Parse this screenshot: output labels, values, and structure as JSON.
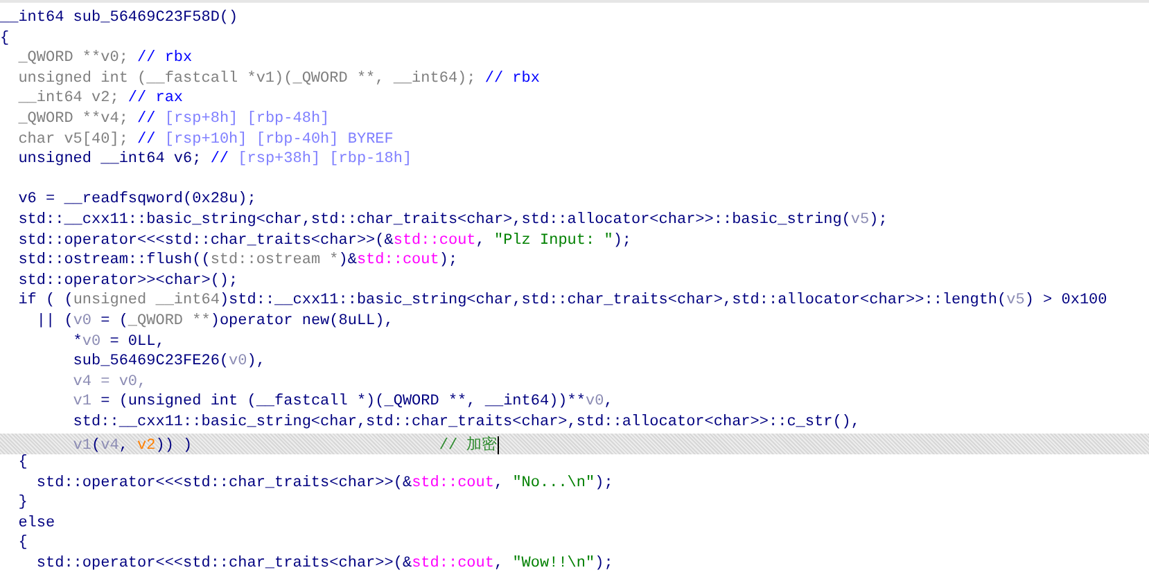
{
  "code_lines": [
    {
      "selected": false,
      "tokens": [
        {
          "kind": "plain",
          "text": "__int64 sub_56469C23F58D()"
        }
      ]
    },
    {
      "selected": false,
      "tokens": [
        {
          "kind": "plain",
          "text": "{"
        }
      ]
    },
    {
      "selected": false,
      "tokens": [
        {
          "kind": "decl",
          "text": "  _QWORD **v0; "
        },
        {
          "kind": "comment",
          "text": "// rbx"
        }
      ]
    },
    {
      "selected": false,
      "tokens": [
        {
          "kind": "decl",
          "text": "  unsigned int (__fastcall *v1)(_QWORD **, __int64); "
        },
        {
          "kind": "comment",
          "text": "// rbx"
        }
      ]
    },
    {
      "selected": false,
      "tokens": [
        {
          "kind": "decl",
          "text": "  __int64 v2; "
        },
        {
          "kind": "comment",
          "text": "// rax"
        }
      ]
    },
    {
      "selected": false,
      "tokens": [
        {
          "kind": "decl",
          "text": "  _QWORD **v4; "
        },
        {
          "kind": "comment",
          "text": "// "
        },
        {
          "kind": "stack",
          "text": "[rsp+8h] [rbp-48h]"
        }
      ]
    },
    {
      "selected": false,
      "tokens": [
        {
          "kind": "decl",
          "text": "  char v5[40]; "
        },
        {
          "kind": "comment",
          "text": "// "
        },
        {
          "kind": "stack",
          "text": "[rsp+10h] [rbp-40h] BYREF"
        }
      ]
    },
    {
      "selected": false,
      "tokens": [
        {
          "kind": "plain",
          "text": "  unsigned __int64 v6; "
        },
        {
          "kind": "comment",
          "text": "// "
        },
        {
          "kind": "stack",
          "text": "[rsp+38h] [rbp-18h]"
        }
      ]
    },
    {
      "selected": false
    },
    {
      "selected": false,
      "tokens": [
        {
          "kind": "plain",
          "text": "  v6 = __readfsqword(0x28u);"
        }
      ]
    },
    {
      "selected": false,
      "tokens": [
        {
          "kind": "plain",
          "text": "  std::__cxx11::basic_string<char,std::char_traits<char>,std::allocator<char>>::basic_string("
        },
        {
          "kind": "var",
          "text": "v5"
        },
        {
          "kind": "plain",
          "text": ");"
        }
      ]
    },
    {
      "selected": false,
      "tokens": [
        {
          "kind": "plain",
          "text": "  std::operator<<<std::char_traits<char>>(&"
        },
        {
          "kind": "global",
          "text": "std::cout"
        },
        {
          "kind": "plain",
          "text": ", "
        },
        {
          "kind": "string",
          "text": "\"Plz Input: \""
        },
        {
          "kind": "plain",
          "text": ");"
        }
      ]
    },
    {
      "selected": false,
      "tokens": [
        {
          "kind": "plain",
          "text": "  std::ostream::flush(("
        },
        {
          "kind": "decl",
          "text": "std::ostream *"
        },
        {
          "kind": "plain",
          "text": ")&"
        },
        {
          "kind": "global",
          "text": "std::cout"
        },
        {
          "kind": "plain",
          "text": ");"
        }
      ]
    },
    {
      "selected": false,
      "tokens": [
        {
          "kind": "plain",
          "text": "  std::operator>><char>();"
        }
      ]
    },
    {
      "selected": false,
      "tokens": [
        {
          "kind": "plain",
          "text": "  if ( ("
        },
        {
          "kind": "decl",
          "text": "unsigned __int64"
        },
        {
          "kind": "plain",
          "text": ")std::__cxx11::basic_string<char,std::char_traits<char>,std::allocator<char>>::length("
        },
        {
          "kind": "var",
          "text": "v5"
        },
        {
          "kind": "plain",
          "text": ") > 0x100"
        }
      ]
    },
    {
      "selected": false,
      "tokens": [
        {
          "kind": "plain",
          "text": "    || ("
        },
        {
          "kind": "var",
          "text": "v0"
        },
        {
          "kind": "plain",
          "text": " = ("
        },
        {
          "kind": "decl",
          "text": "_QWORD **"
        },
        {
          "kind": "plain",
          "text": ")operator new(8uLL),"
        }
      ]
    },
    {
      "selected": false,
      "tokens": [
        {
          "kind": "plain",
          "text": "        *"
        },
        {
          "kind": "var",
          "text": "v0"
        },
        {
          "kind": "plain",
          "text": " = 0LL,"
        }
      ]
    },
    {
      "selected": false,
      "tokens": [
        {
          "kind": "plain",
          "text": "        sub_56469C23FE26("
        },
        {
          "kind": "var",
          "text": "v0"
        },
        {
          "kind": "plain",
          "text": "),"
        }
      ]
    },
    {
      "selected": false,
      "tokens": [
        {
          "kind": "var",
          "text": "        v4 = v0,"
        }
      ]
    },
    {
      "selected": false,
      "tokens": [
        {
          "kind": "var",
          "text": "        v1"
        },
        {
          "kind": "plain",
          "text": " = (unsigned int (__fastcall *)(_QWORD **, __int64))**"
        },
        {
          "kind": "var",
          "text": "v0"
        },
        {
          "kind": "plain",
          "text": ","
        }
      ]
    },
    {
      "selected": false,
      "tokens": [
        {
          "kind": "plain",
          "text": "        std::__cxx11::basic_string<char,std::char_traits<char>,std::allocator<char>>::c_str(),"
        }
      ]
    },
    {
      "selected": true,
      "tokens": [
        {
          "kind": "var",
          "text": "        v1"
        },
        {
          "kind": "plain",
          "text": "("
        },
        {
          "kind": "var",
          "text": "v4"
        },
        {
          "kind": "plain",
          "text": ", "
        },
        {
          "kind": "arg",
          "text": "v2"
        },
        {
          "kind": "plain",
          "text": ")) )                           "
        },
        {
          "kind": "note",
          "text": "// 加密"
        }
      ]
    },
    {
      "selected": false,
      "tokens": [
        {
          "kind": "plain",
          "text": "  {"
        }
      ]
    },
    {
      "selected": false,
      "tokens": [
        {
          "kind": "plain",
          "text": "    std::operator<<<std::char_traits<char>>(&"
        },
        {
          "kind": "global",
          "text": "std::cout"
        },
        {
          "kind": "plain",
          "text": ", "
        },
        {
          "kind": "string",
          "text": "\"No...\\n\""
        },
        {
          "kind": "plain",
          "text": ");"
        }
      ]
    },
    {
      "selected": false,
      "tokens": [
        {
          "kind": "plain",
          "text": "  }"
        }
      ]
    },
    {
      "selected": false,
      "tokens": [
        {
          "kind": "plain",
          "text": "  else"
        }
      ]
    },
    {
      "selected": false,
      "tokens": [
        {
          "kind": "plain",
          "text": "  {"
        }
      ]
    },
    {
      "selected": false,
      "tokens": [
        {
          "kind": "plain",
          "text": "    std::operator<<<std::char_traits<char>>(&"
        },
        {
          "kind": "global",
          "text": "std::cout"
        },
        {
          "kind": "plain",
          "text": ", "
        },
        {
          "kind": "string",
          "text": "\"Wow!!\\n\""
        },
        {
          "kind": "plain",
          "text": ");"
        }
      ]
    }
  ]
}
